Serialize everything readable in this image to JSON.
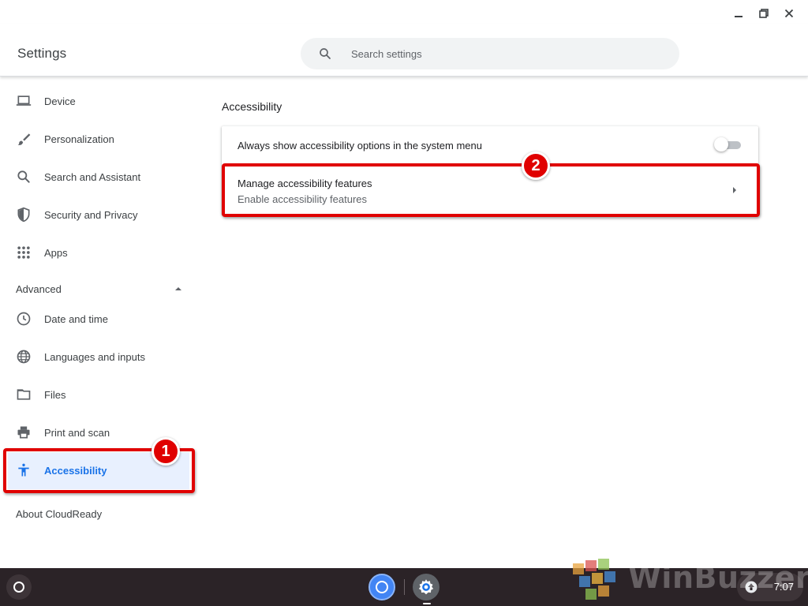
{
  "window": {
    "controls": [
      {
        "name": "minimize",
        "icon": "minimize-icon"
      },
      {
        "name": "restore",
        "icon": "restore-icon"
      },
      {
        "name": "close",
        "icon": "close-icon"
      }
    ]
  },
  "header": {
    "title": "Settings",
    "search_placeholder": "Search settings",
    "search_value": ""
  },
  "sidebar": {
    "items": [
      {
        "label": "Device",
        "icon": "laptop-icon"
      },
      {
        "label": "Personalization",
        "icon": "brush-icon"
      },
      {
        "label": "Search and Assistant",
        "icon": "search-icon"
      },
      {
        "label": "Security and Privacy",
        "icon": "shield-icon"
      },
      {
        "label": "Apps",
        "icon": "apps-grid-icon"
      }
    ],
    "advanced_label": "Advanced",
    "advanced_items": [
      {
        "label": "Date and time",
        "icon": "clock-icon"
      },
      {
        "label": "Languages and inputs",
        "icon": "globe-icon"
      },
      {
        "label": "Files",
        "icon": "folder-icon"
      },
      {
        "label": "Print and scan",
        "icon": "printer-icon"
      },
      {
        "label": "Accessibility",
        "icon": "accessibility-icon",
        "selected": true
      }
    ],
    "about_label": "About CloudReady"
  },
  "main": {
    "section_title": "Accessibility",
    "rows": [
      {
        "label": "Always show accessibility options in the system menu",
        "control": "toggle",
        "checked": false
      },
      {
        "label": "Manage accessibility features",
        "sublabel": "Enable accessibility features",
        "control": "arrow"
      }
    ]
  },
  "annotations": [
    {
      "number": "1",
      "color": "#e00000"
    },
    {
      "number": "2",
      "color": "#e00000"
    }
  ],
  "taskbar": {
    "apps": [
      "chrome",
      "settings"
    ],
    "clock": "7:07"
  },
  "watermark": {
    "text": "WinBuzzer"
  },
  "colors": {
    "accent": "#1a73e8",
    "selected_bg": "#e8f0fe",
    "highlight": "#e00000",
    "taskbar_bg": "#2b2327"
  }
}
